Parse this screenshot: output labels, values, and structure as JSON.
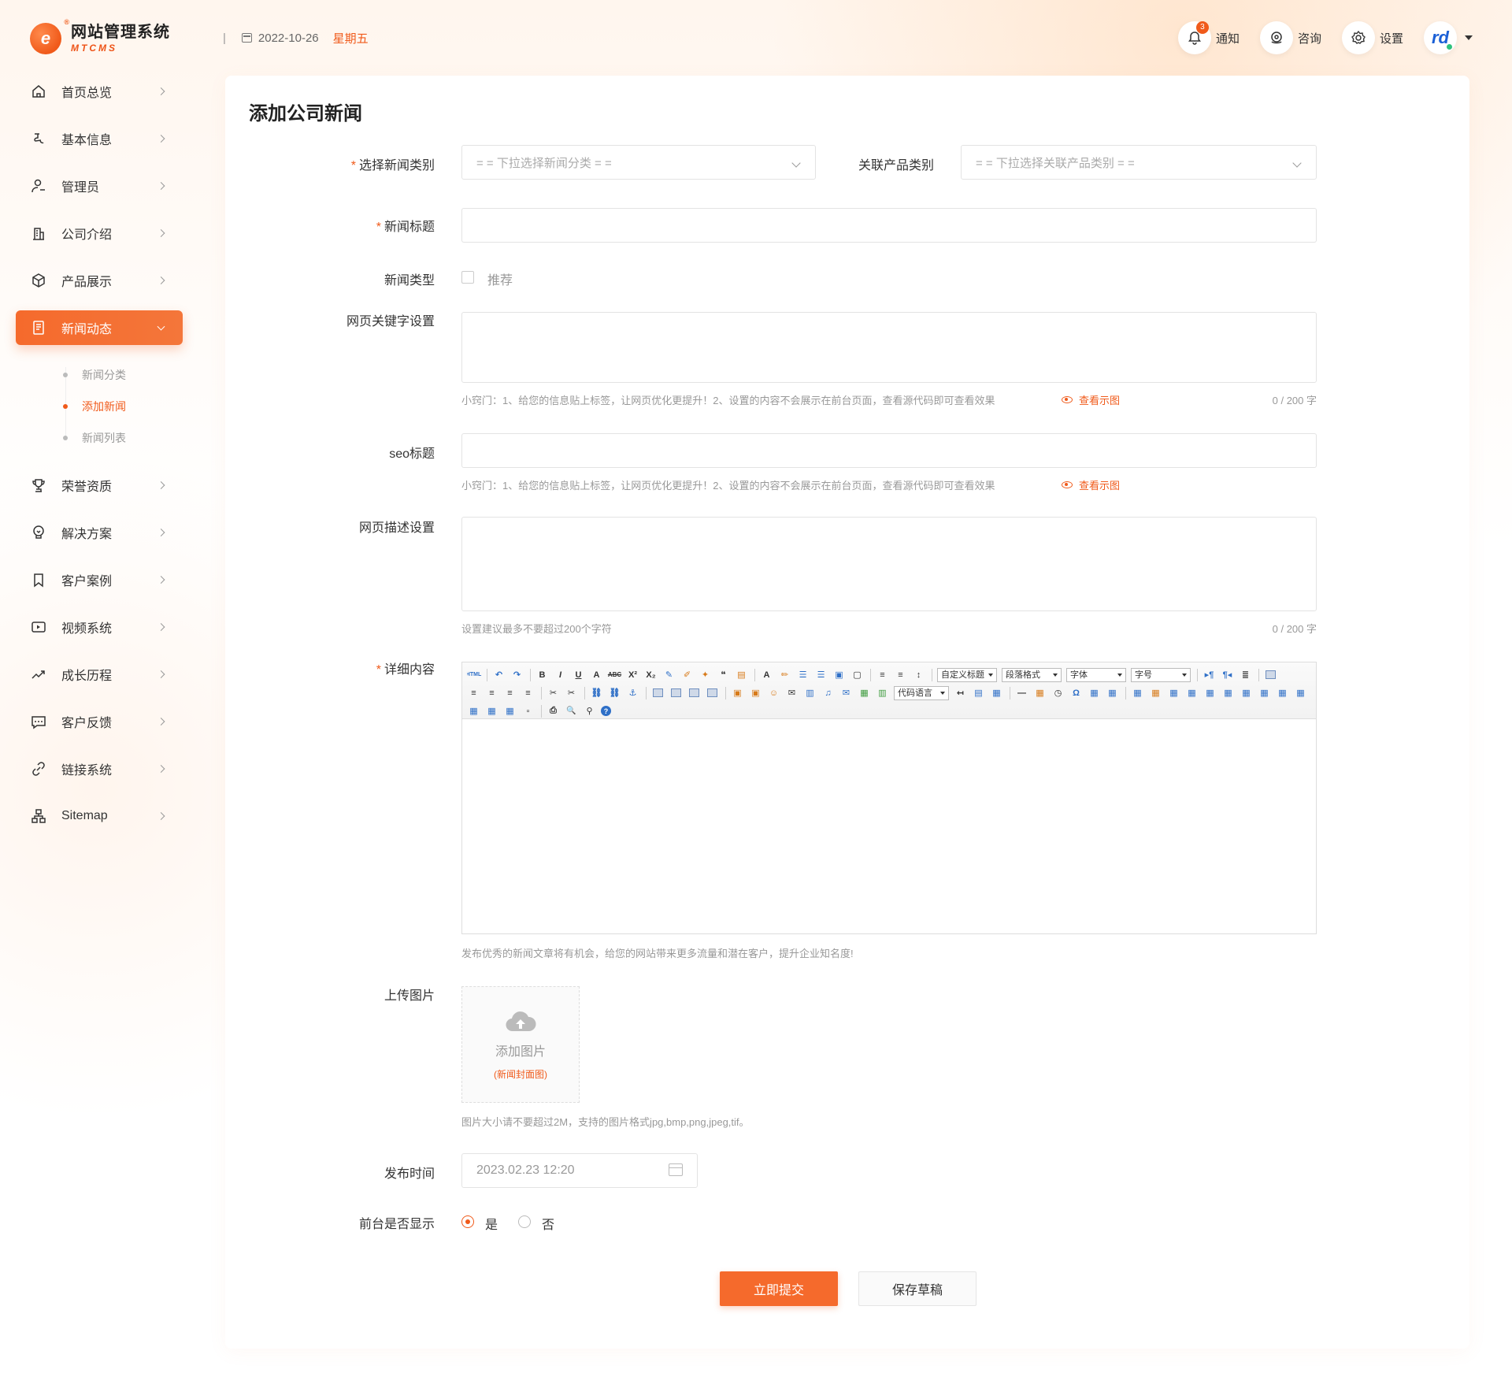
{
  "app": {
    "logo_mark": "e",
    "title": "网站管理系统",
    "subtitle": "MTCMS"
  },
  "header": {
    "separator": "|",
    "date": "2022-10-26",
    "weekday": "星期五",
    "notify_label": "通知",
    "notify_count": "3",
    "consult_label": "咨询",
    "settings_label": "设置",
    "avatar_letter": "rd"
  },
  "sidebar": {
    "items": [
      {
        "label": "首页总览",
        "icon": "home-icon"
      },
      {
        "label": "基本信息",
        "icon": "info-icon"
      },
      {
        "label": "管理员",
        "icon": "user-icon"
      },
      {
        "label": "公司介绍",
        "icon": "building-icon"
      },
      {
        "label": "产品展示",
        "icon": "box-icon"
      },
      {
        "label": "新闻动态",
        "icon": "news-icon"
      },
      {
        "label": "荣誉资质",
        "icon": "trophy-icon"
      },
      {
        "label": "解决方案",
        "icon": "bulb-icon"
      },
      {
        "label": "客户案例",
        "icon": "bookmark-icon"
      },
      {
        "label": "视频系统",
        "icon": "video-icon"
      },
      {
        "label": "成长历程",
        "icon": "trend-icon"
      },
      {
        "label": "客户反馈",
        "icon": "message-icon"
      },
      {
        "label": "链接系统",
        "icon": "link-icon"
      },
      {
        "label": "Sitemap",
        "icon": "sitemap-icon"
      }
    ],
    "sub_items": [
      {
        "label": "新闻分类"
      },
      {
        "label": "添加新闻"
      },
      {
        "label": "新闻列表"
      }
    ]
  },
  "form": {
    "page_title": "添加公司新闻",
    "required_mark": "*",
    "category_label": "选择新闻类别",
    "category_placeholder": "= = 下拉选择新闻分类 = =",
    "product_category_label": "关联产品类别",
    "product_category_placeholder": "= = 下拉选择关联产品类别 = =",
    "title_label": "新闻标题",
    "title_value": "",
    "type_label": "新闻类型",
    "type_option": "推荐",
    "keywords_label": "网页关键字设置",
    "keywords_hint": "小窍门：1、给您的信息贴上标签，让网页优化更提升！2、设置的内容不会展示在前台页面，查看源代码即可查看效果",
    "view_example": "查看示图",
    "keywords_counter": "0 / 200 字",
    "seo_title_label": "seo标题",
    "seo_hint": "小窍门：1、给您的信息贴上标签，让网页优化更提升！2、设置的内容不会展示在前台页面，查看源代码即可查看效果",
    "description_label": "网页描述设置",
    "description_hint": "设置建议最多不要超过200个字符",
    "description_counter": "0 / 200 字",
    "content_label": "详细内容",
    "content_hint": "发布优秀的新闻文章将有机会，给您的网站带来更多流量和潜在客户，提升企业知名度!",
    "upload_label": "上传图片",
    "upload_text": "添加图片",
    "upload_sub": "(新闻封面图)",
    "upload_hint": "图片大小请不要超过2M，支持的图片格式jpg,bmp,png,jpeg,tif。",
    "publish_time_label": "发布时间",
    "publish_time_value": "2023.02.23 12:20",
    "display_label": "前台是否显示",
    "display_yes": "是",
    "display_no": "否",
    "submit_label": "立即提交",
    "draft_label": "保存草稿"
  },
  "editor": {
    "row1": [
      "HTML",
      "↶",
      "↷",
      "B",
      "I",
      "U",
      "A",
      "ABC",
      "X²",
      "X₂",
      "✎",
      "✐",
      "✦",
      "❝",
      "▤",
      "A",
      "✏",
      "☰",
      "☰",
      "▣",
      "▢",
      "≡",
      "≡",
      "↕"
    ],
    "combos": [
      "自定义标题",
      "段落格式",
      "字体",
      "字号"
    ],
    "row2_combo": "代码语言",
    "row2": [
      "≡",
      "≡",
      "≡",
      "≡",
      "✂",
      "✂",
      "⛓",
      "⛓",
      "⚓",
      "▭",
      "▭",
      "▭",
      "▭",
      "▣",
      "▣",
      "☺",
      "✉",
      "▥",
      "♫",
      "✉",
      "▦",
      "▥"
    ],
    "row2_tail": [
      "↤",
      "▤",
      "▦",
      "—",
      "▦",
      "◷",
      "Ω",
      "▦",
      "▦",
      "▦",
      "▦",
      "▦",
      "▦",
      "▦",
      "▦",
      "▦",
      "▦",
      "▦",
      "▦",
      "▦"
    ],
    "row3": [
      "▦",
      "▦",
      "▦",
      "▫",
      "⎙",
      "🔍",
      "⚲",
      "?"
    ],
    "colors": {
      "accent": "#f05a1a",
      "link": "#2e6fc7"
    }
  },
  "colors": {
    "accent": "#f05a1a",
    "accent_light": "#f56a2c",
    "text": "#333333",
    "muted": "#999999"
  }
}
